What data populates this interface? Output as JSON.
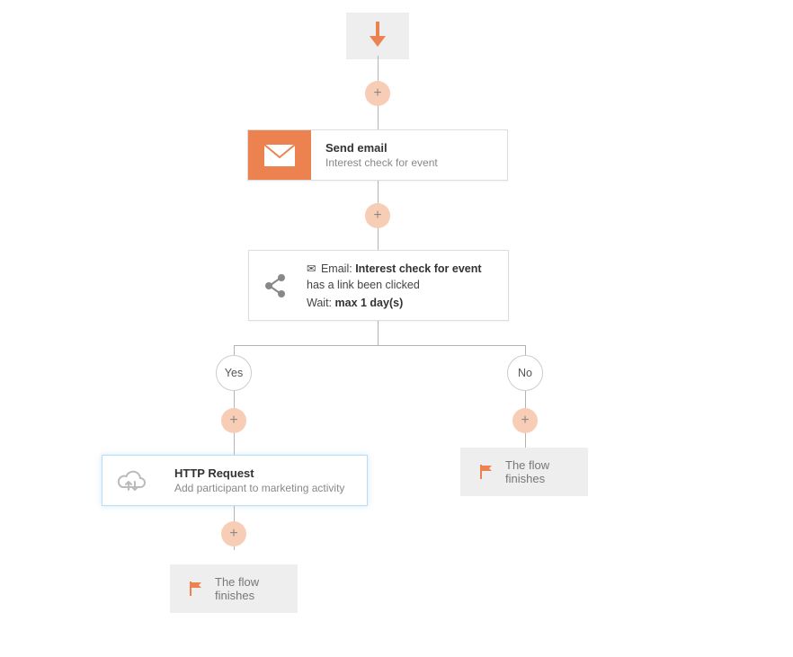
{
  "start": {},
  "sendEmail": {
    "title": "Send email",
    "subtitle": "Interest check for event"
  },
  "decision": {
    "prefix_icon": "envelope",
    "prefix_label": "Email:",
    "email_name": "Interest check for event",
    "suffix1": "has a link been clicked",
    "wait_label": "Wait:",
    "wait_value": "max 1 day(s)"
  },
  "branches": {
    "yes": "Yes",
    "no": "No"
  },
  "httpRequest": {
    "title": "HTTP Request",
    "subtitle": "Add participant to marketing activity"
  },
  "end": {
    "text": "The flow finishes"
  },
  "colors": {
    "accent": "#ed8251",
    "accent_light": "#f7cdb5",
    "line": "#b4b4b4",
    "bg_grey": "#eeeeee"
  }
}
